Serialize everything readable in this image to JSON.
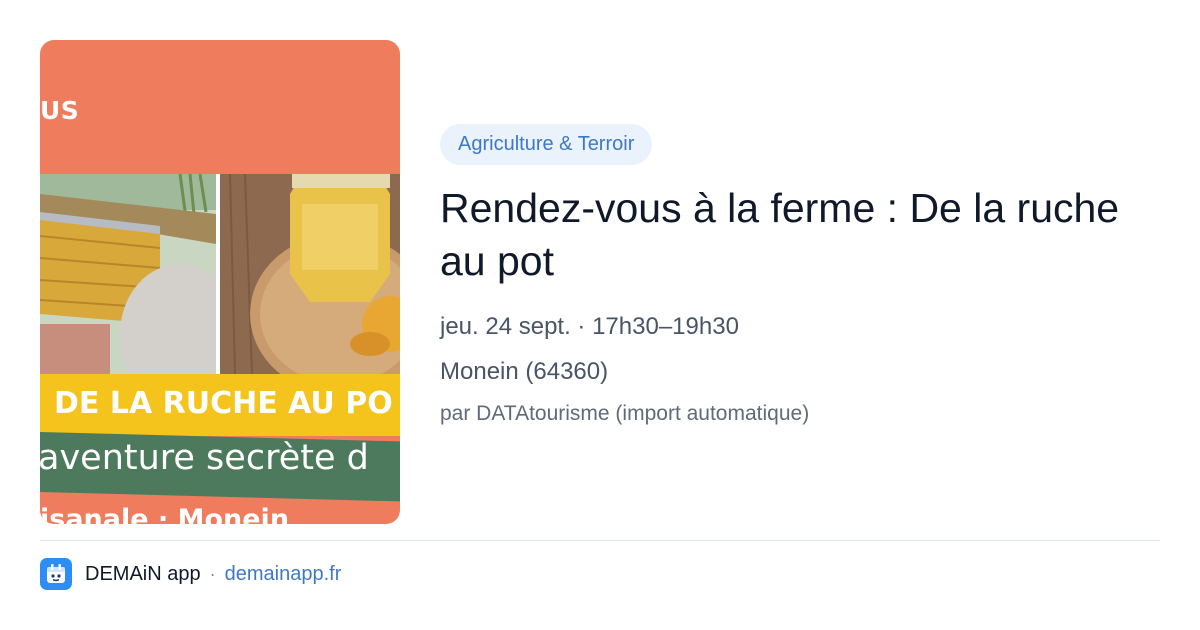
{
  "image": {
    "top_text": "US",
    "band_yellow_text": "DE LA RUCHE AU PO",
    "band_green_text": "aventure secrète d",
    "bottom_text": "isanale · Monein"
  },
  "event": {
    "category": "Agriculture & Terroir",
    "title": "Rendez-vous à la ferme : De la ruche au pot",
    "datetime": "jeu. 24 sept. · 17h30–19h30",
    "location": "Monein (64360)",
    "source": "par DATAtourisme (import automatique)"
  },
  "footer": {
    "app_name": "DEMAiN app",
    "separator": "·",
    "url": "demainapp.fr"
  },
  "colors": {
    "image_background": "#ef7c5c",
    "yellow_band": "#f4c41c",
    "green_band": "#4d7a5d",
    "accent_blue": "#3f78c6",
    "pill_background": "#eaf2fb",
    "app_icon": "#2c8df4"
  },
  "icons": {
    "app": "demain-app-icon"
  }
}
